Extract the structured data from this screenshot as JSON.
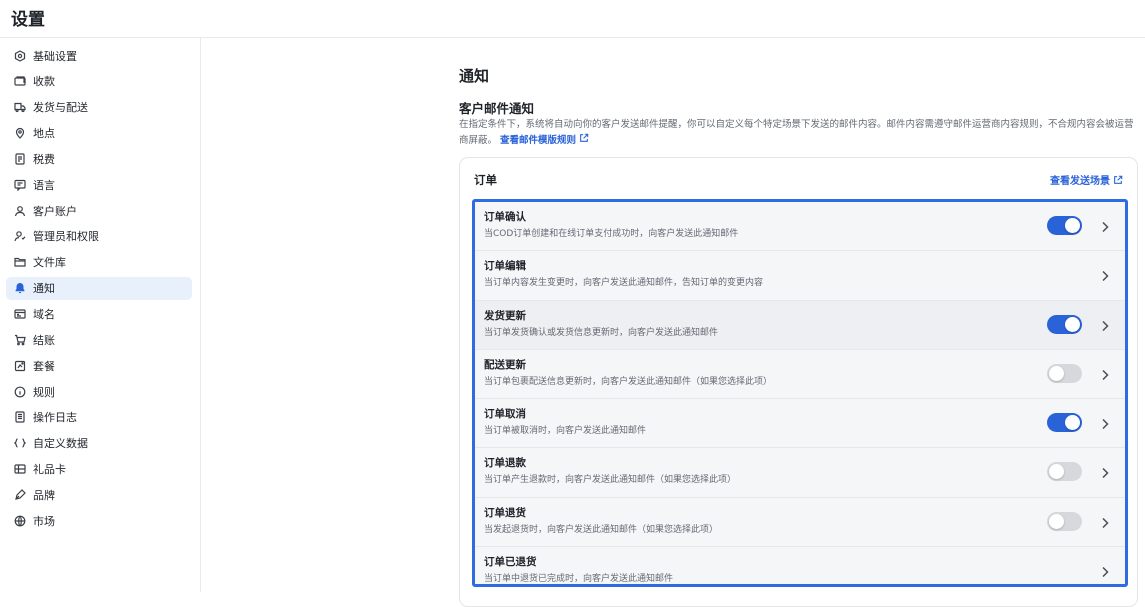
{
  "header": {
    "title": "设置"
  },
  "sidebar": {
    "items": [
      {
        "label": "基础设置",
        "icon": "store-settings-icon"
      },
      {
        "label": "收款",
        "icon": "payment-icon"
      },
      {
        "label": "发货与配送",
        "icon": "truck-icon"
      },
      {
        "label": "地点",
        "icon": "location-pin-icon"
      },
      {
        "label": "税费",
        "icon": "tax-receipt-icon"
      },
      {
        "label": "语言",
        "icon": "language-icon"
      },
      {
        "label": "客户账户",
        "icon": "user-icon"
      },
      {
        "label": "管理员和权限",
        "icon": "user-permission-icon"
      },
      {
        "label": "文件库",
        "icon": "folder-icon"
      },
      {
        "label": "通知",
        "icon": "bell-icon",
        "active": true
      },
      {
        "label": "域名",
        "icon": "domain-icon"
      },
      {
        "label": "结账",
        "icon": "cart-icon"
      },
      {
        "label": "套餐",
        "icon": "plan-icon"
      },
      {
        "label": "规则",
        "icon": "info-circle-icon"
      },
      {
        "label": "操作日志",
        "icon": "log-icon"
      },
      {
        "label": "自定义数据",
        "icon": "code-brackets-icon"
      },
      {
        "label": "礼品卡",
        "icon": "gift-card-icon"
      },
      {
        "label": "品牌",
        "icon": "brand-icon"
      },
      {
        "label": "市场",
        "icon": "globe-icon"
      }
    ]
  },
  "main": {
    "title": "通知",
    "section_title": "客户邮件通知",
    "description": "在指定条件下，系统将自动向你的客户发送邮件提醒，你可以自定义每个特定场景下发送的邮件内容。邮件内容需遵守邮件运营商内容规则，不合规内容会被运营商屏蔽。",
    "template_link": "查看邮件模版规则",
    "card": {
      "title": "订单",
      "scenario_link": "查看发送场景",
      "rows": [
        {
          "name": "订单确认",
          "desc": "当COD订单创建和在线订单支付成功时，向客户发送此通知邮件",
          "toggle": "on"
        },
        {
          "name": "订单编辑",
          "desc": "当订单内容发生变更时，向客户发送此通知邮件，告知订单的变更内容",
          "toggle": "none"
        },
        {
          "name": "发货更新",
          "desc": "当订单发货确认或发货信息更新时，向客户发送此通知邮件",
          "toggle": "on"
        },
        {
          "name": "配送更新",
          "desc": "当订单包裹配送信息更新时，向客户发送此通知邮件（如果您选择此项）",
          "toggle": "off"
        },
        {
          "name": "订单取消",
          "desc": "当订单被取消时，向客户发送此通知邮件",
          "toggle": "on"
        },
        {
          "name": "订单退款",
          "desc": "当订单产生退款时，向客户发送此通知邮件（如果您选择此项）",
          "toggle": "off"
        },
        {
          "name": "订单退货",
          "desc": "当发起退货时，向客户发送此通知邮件（如果您选择此项）",
          "toggle": "off"
        },
        {
          "name": "订单已退货",
          "desc": "当订单中退货已完成时，向客户发送此通知邮件",
          "toggle": "none"
        }
      ]
    }
  },
  "colors": {
    "accent": "#2a62d8",
    "highlight_border": "#2f6be4",
    "active_bg": "#e8f0fc"
  }
}
